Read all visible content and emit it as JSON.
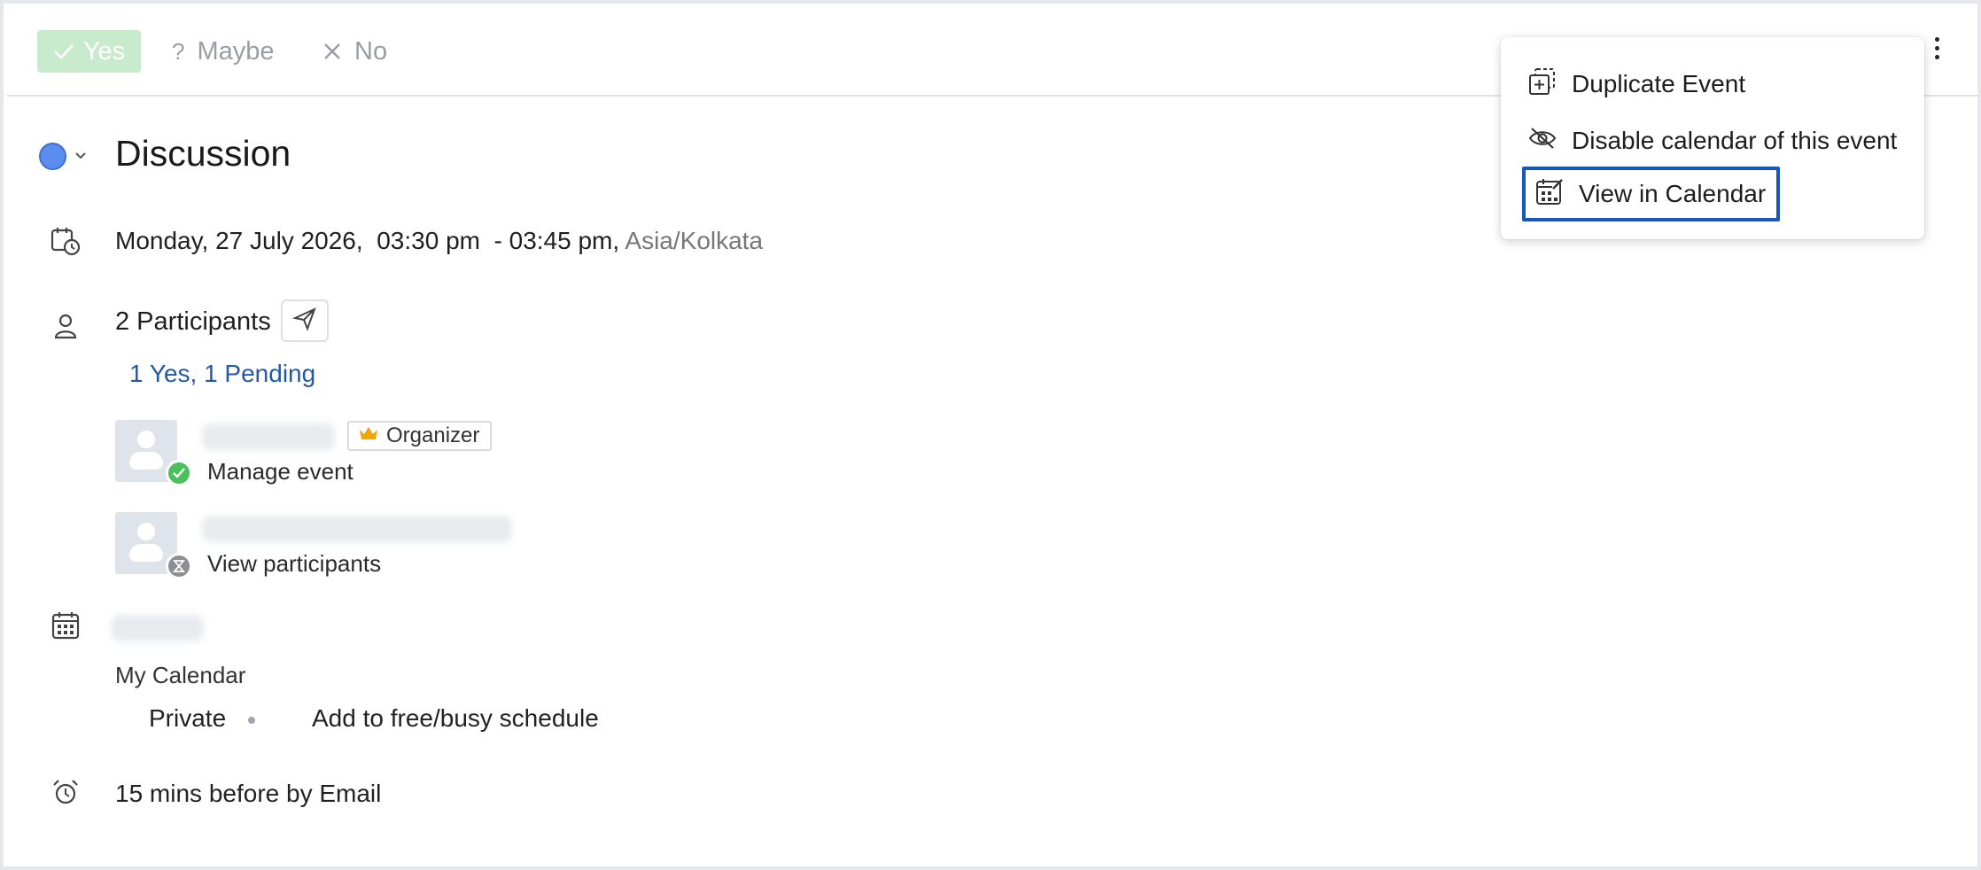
{
  "rsvp": {
    "yes_label": "Yes",
    "maybe_label": "Maybe",
    "no_label": "No",
    "yes_color": "#c9ebcd"
  },
  "event": {
    "title": "Discussion",
    "color": "#5b8def",
    "datetime": "Monday, 27 July 2026,  03:30 pm  - 03:45 pm,",
    "timezone": "Asia/Kolkata"
  },
  "participants": {
    "count_label": "2 Participants",
    "status_summary": "1 Yes, 1 Pending",
    "list": [
      {
        "role_badge": "Organizer",
        "action": "Manage event",
        "status": "accepted"
      },
      {
        "action": "View participants",
        "status": "pending"
      }
    ]
  },
  "calendar": {
    "name": "My Calendar",
    "visibility": "Private",
    "freebusy": "Add to free/busy schedule"
  },
  "reminder": {
    "text": "15 mins before by Email"
  },
  "menu": {
    "items": [
      {
        "label": "Duplicate Event",
        "icon": "duplicate-icon"
      },
      {
        "label": "Disable calendar of this event",
        "icon": "eye-off-icon"
      },
      {
        "label": "View in Calendar",
        "icon": "calendar-view-icon",
        "selected": true
      }
    ],
    "highlight_color": "#1456c2"
  }
}
